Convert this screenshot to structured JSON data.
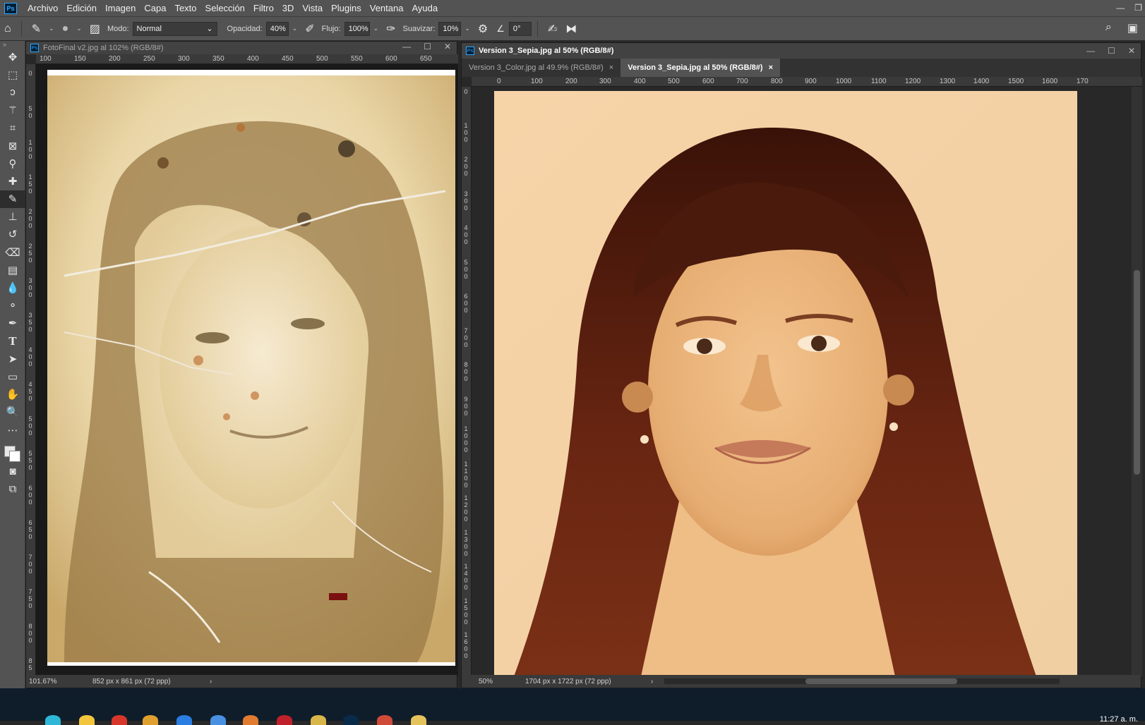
{
  "menubar": {
    "logo": "Ps",
    "items": [
      "Archivo",
      "Edición",
      "Imagen",
      "Capa",
      "Texto",
      "Selección",
      "Filtro",
      "3D",
      "Vista",
      "Plugins",
      "Ventana",
      "Ayuda"
    ]
  },
  "options": {
    "modo_label": "Modo:",
    "modo_value": "Normal",
    "opacidad_label": "Opacidad:",
    "opacidad_value": "40%",
    "flujo_label": "Flujo:",
    "flujo_value": "100%",
    "suavizar_label": "Suavizar:",
    "suavizar_value": "10%",
    "angle_value": "0°"
  },
  "tools": [
    "move-tool",
    "marquee-tool",
    "lasso-tool",
    "magic-wand-tool",
    "crop-tool",
    "frame-tool",
    "eyedropper-tool",
    "healing-brush-tool",
    "brush-tool",
    "clone-stamp-tool",
    "history-brush-tool",
    "eraser-tool",
    "gradient-tool",
    "blur-tool",
    "dodge-tool",
    "pen-tool",
    "type-tool",
    "path-selection-tool",
    "rectangle-tool",
    "hand-tool",
    "zoom-tool",
    "more-tools"
  ],
  "left_doc": {
    "title": "FotoFinal v2.jpg al 102% (RGB/8#)",
    "ruler_ticks": [
      "100",
      "150",
      "200",
      "250",
      "300",
      "350",
      "400",
      "450",
      "500",
      "550",
      "600",
      "650"
    ],
    "vruler_ticks": [
      "0",
      "50",
      "100",
      "150",
      "200",
      "250",
      "300",
      "350",
      "400",
      "450",
      "500",
      "550",
      "600",
      "650",
      "700",
      "750",
      "800",
      "85"
    ],
    "zoom": "101.67%",
    "dimensions": "852 px x 861 px (72 ppp)"
  },
  "right_doc": {
    "title": "Version 3_Sepia.jpg al 50% (RGB/8#)",
    "tabs": [
      {
        "label": "Version 3_Color.jpg al 49.9% (RGB/8#)",
        "close": "×"
      },
      {
        "label": "Version 3_Sepia.jpg al 50% (RGB/8#)",
        "close": "×"
      }
    ],
    "ruler_ticks": [
      "0",
      "100",
      "200",
      "300",
      "400",
      "500",
      "600",
      "700",
      "800",
      "900",
      "1000",
      "1100",
      "1200",
      "1300",
      "1400",
      "1500",
      "1600",
      "170"
    ],
    "vruler_ticks": [
      "0",
      "100",
      "200",
      "300",
      "400",
      "500",
      "600",
      "700",
      "800",
      "900",
      "1000",
      "1100",
      "1200",
      "1300",
      "1400",
      "1500",
      "1600"
    ],
    "zoom": "50%",
    "dimensions": "1704 px x 1722 px (72 ppp)"
  },
  "taskbar": {
    "clock": "11:27 a. m."
  }
}
